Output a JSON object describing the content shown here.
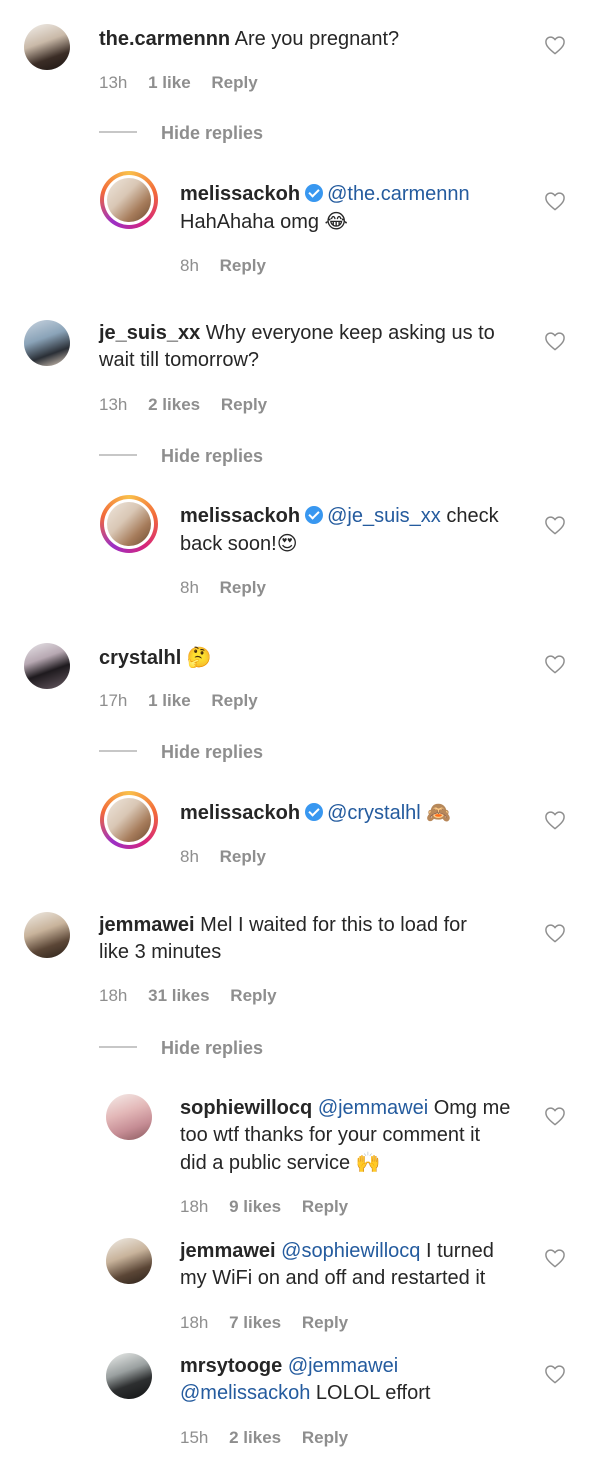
{
  "comments": [
    {
      "user": "the.carmennn",
      "text": "Are you pregnant?",
      "time": "13h",
      "likes": "1 like",
      "reply": "Reply",
      "hide": "Hide replies",
      "replies": [
        {
          "user": "melissackoh",
          "mention": "@the.carmennn",
          "text_line2": "HahAhaha omg",
          "emoji": "😂",
          "time": "8h",
          "reply": "Reply"
        }
      ]
    },
    {
      "user": "je_suis_xx",
      "text": "Why everyone keep asking us to",
      "text_line2": "wait till tomorrow?",
      "time": "13h",
      "likes": "2 likes",
      "reply": "Reply",
      "hide": "Hide replies",
      "replies": [
        {
          "user": "melissackoh",
          "mention": "@je_suis_xx",
          "text": "check",
          "text_line2": "back soon!",
          "emoji": "😍",
          "time": "8h",
          "reply": "Reply"
        }
      ]
    },
    {
      "user": "crystalhl",
      "emoji": "🤔",
      "time": "17h",
      "likes": "1 like",
      "reply": "Reply",
      "hide": "Hide replies",
      "replies": [
        {
          "user": "melissackoh",
          "mention": "@crystalhl",
          "emoji": "🙈",
          "time": "8h",
          "reply": "Reply"
        }
      ]
    },
    {
      "user": "jemmawei",
      "text": "Mel I waited for this to load for",
      "text_line2": "like 3 minutes",
      "time": "18h",
      "likes": "31 likes",
      "reply": "Reply",
      "hide": "Hide replies",
      "replies": [
        {
          "user": "sophiewillocq",
          "mention": "@jemmawei",
          "text": "Omg me",
          "text_line2": "too wtf thanks for your comment it",
          "text_line3": "did a public service",
          "emoji": "🙌",
          "time": "18h",
          "likes": "9 likes",
          "reply": "Reply"
        },
        {
          "user": "jemmawei",
          "mention": "@sophiewillocq",
          "text": "I turned",
          "text_line2": "my WiFi on and off and restarted it",
          "time": "18h",
          "likes": "7 likes",
          "reply": "Reply"
        },
        {
          "user": "mrsytooge",
          "mention": "@jemmawei",
          "mention2": "@melissackoh",
          "text_line2": "LOLOL effort",
          "time": "15h",
          "likes": "2 likes",
          "reply": "Reply"
        }
      ]
    }
  ]
}
